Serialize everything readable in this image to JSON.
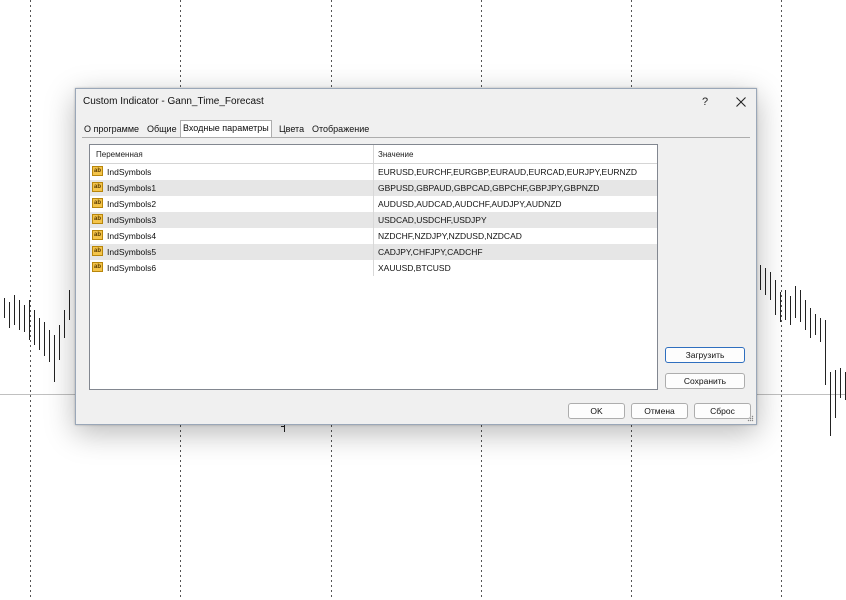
{
  "dialog": {
    "title": "Custom Indicator - Gann_Time_Forecast",
    "help_label": "?",
    "close_icon": "close-icon"
  },
  "tabs": [
    {
      "label": "О программе"
    },
    {
      "label": "Общие"
    },
    {
      "label": "Входные параметры",
      "active": true
    },
    {
      "label": "Цвета"
    },
    {
      "label": "Отображение"
    }
  ],
  "grid": {
    "columns": [
      "Переменная",
      "Значение"
    ],
    "type_icon": "ab-string-icon",
    "type_icon_text": "ab",
    "rows": [
      {
        "name": "IndSymbols",
        "value": "EURUSD,EURCHF,EURGBP,EURAUD,EURCAD,EURJPY,EURNZD"
      },
      {
        "name": "IndSymbols1",
        "value": "GBPUSD,GBPAUD,GBPCAD,GBPCHF,GBPJPY,GBPNZD"
      },
      {
        "name": "IndSymbols2",
        "value": "AUDUSD,AUDCAD,AUDCHF,AUDJPY,AUDNZD"
      },
      {
        "name": "IndSymbols3",
        "value": "USDCAD,USDCHF,USDJPY"
      },
      {
        "name": "IndSymbols4",
        "value": "NZDCHF,NZDJPY,NZDUSD,NZDCAD"
      },
      {
        "name": "IndSymbols5",
        "value": "CADJPY,CHFJPY,CADCHF"
      },
      {
        "name": "IndSymbols6",
        "value": "XAUUSD,BTCUSD"
      }
    ]
  },
  "side_buttons": {
    "load": "Загрузить",
    "save": "Сохранить"
  },
  "bottom_buttons": {
    "ok": "OK",
    "cancel": "Отмена",
    "reset": "Сброс"
  }
}
